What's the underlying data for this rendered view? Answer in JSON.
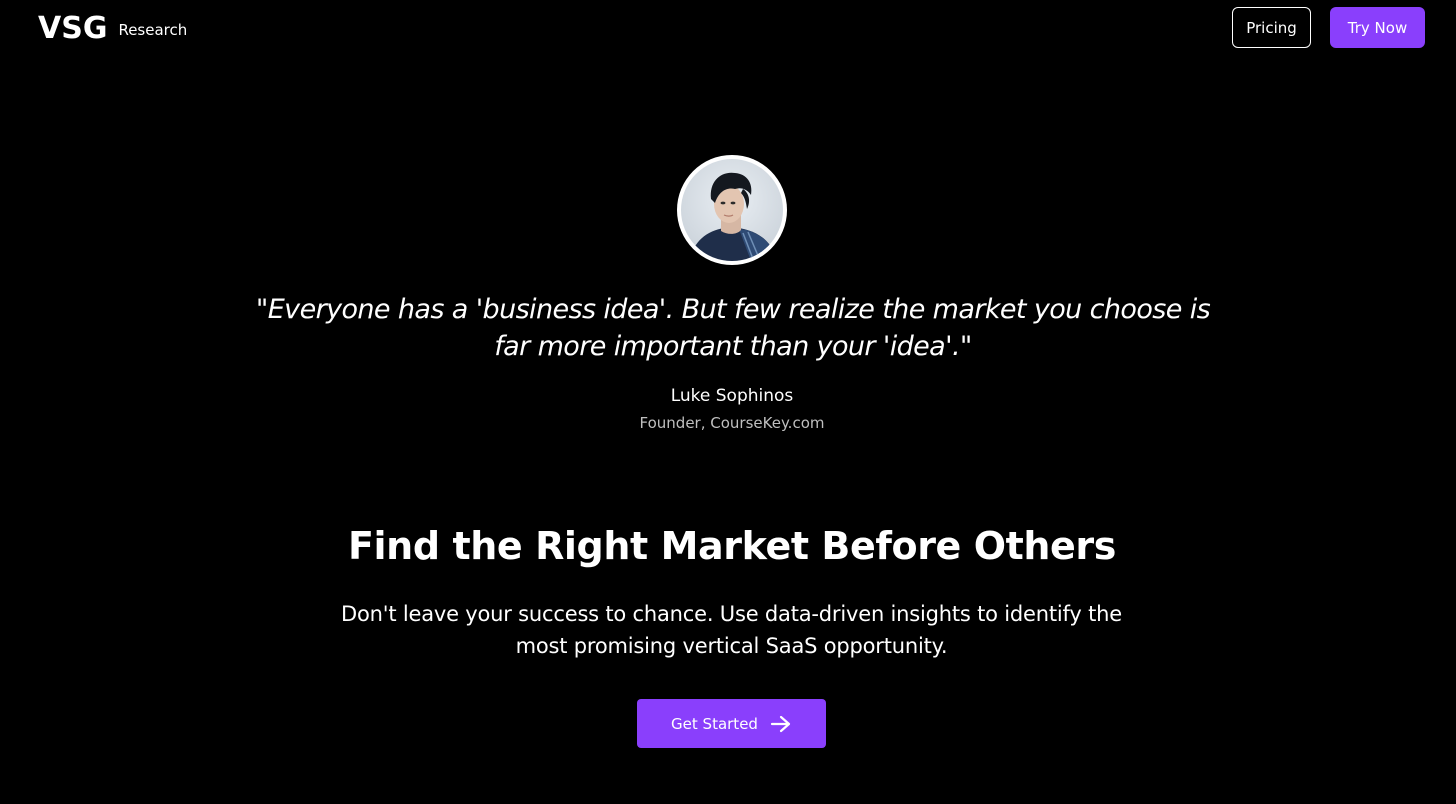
{
  "header": {
    "logo_mark": "VSG",
    "logo_sub": "Research",
    "nav": {
      "pricing_label": "Pricing",
      "try_now_label": "Try Now"
    }
  },
  "testimonial": {
    "avatar": "person-portrait",
    "quote_line1": "\"Everyone has a 'business idea'. But few realize the market you choose is",
    "quote_line2": "far more important than your 'idea'.\"",
    "author_name": "Luke Sophinos",
    "author_role": "Founder, CourseKey.com"
  },
  "hero": {
    "title": "Find the Right Market Before Others",
    "subtitle_line1": "Don't leave your success to chance. Use data-driven insights to identify the",
    "subtitle_line2": "most promising vertical SaaS opportunity.",
    "cta_label": "Get Started",
    "cta_icon": "arrow-right-icon"
  },
  "colors": {
    "background": "#000000",
    "accent": "#8a3ffc",
    "text": "#ffffff",
    "muted_text": "#bfbfbf"
  }
}
